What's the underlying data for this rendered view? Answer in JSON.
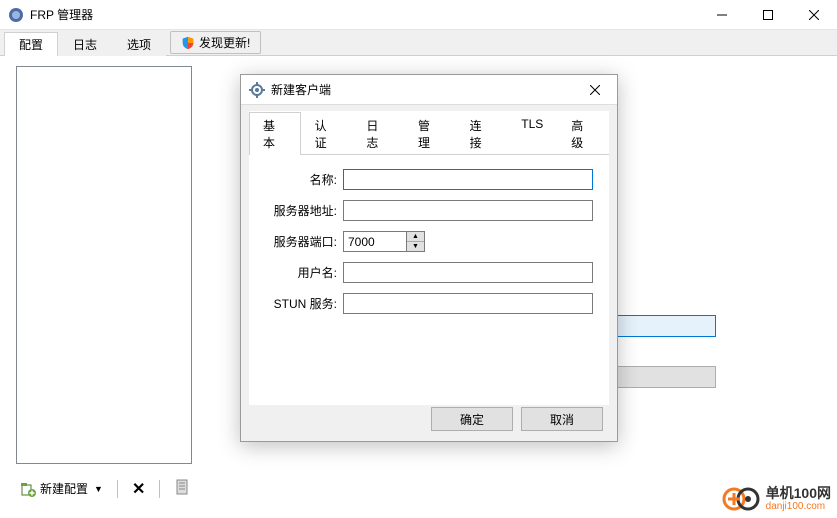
{
  "window": {
    "title": "FRP 管理器"
  },
  "main_tabs": {
    "config": "配置",
    "log": "日志",
    "options": "选项",
    "update": "发现更新!"
  },
  "bottom": {
    "new_config": "新建配置"
  },
  "dialog": {
    "title": "新建客户端",
    "tabs": {
      "basic": "基本",
      "auth": "认证",
      "log": "日志",
      "manage": "管理",
      "connect": "连接",
      "tls": "TLS",
      "advanced": "高级"
    },
    "labels": {
      "name": "名称:",
      "server_addr": "服务器地址:",
      "server_port": "服务器端口:",
      "username": "用户名:",
      "stun": "STUN 服务:"
    },
    "values": {
      "name": "",
      "server_addr": "",
      "server_port": "7000",
      "username": "",
      "stun": ""
    },
    "buttons": {
      "ok": "确定",
      "cancel": "取消"
    }
  },
  "watermark": {
    "cn": "单机100网",
    "url": "danji100.com"
  }
}
